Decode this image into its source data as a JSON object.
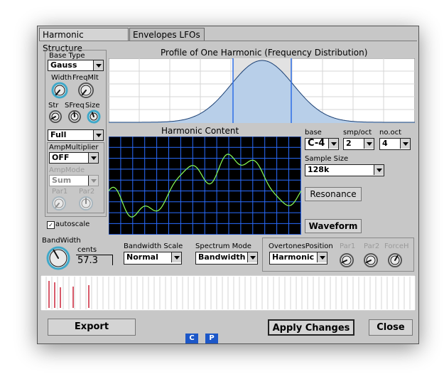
{
  "tabs": {
    "harmonic_structure": "Harmonic Structure",
    "envelopes_lfos": "Envelopes LFOs"
  },
  "base_type": {
    "label": "Base Type",
    "value": "Gauss"
  },
  "knobs": {
    "width": "Width",
    "freqmlt": "FreqMlt",
    "str": "Str",
    "sfreq": "SFreq",
    "size": "Size"
  },
  "full_select": "Full",
  "amp_multiplier": {
    "label": "AmpMultiplier",
    "value": "OFF"
  },
  "amp_mode": {
    "label": "AmpMode",
    "value": "Sum"
  },
  "par_knobs": {
    "par1": "Par1",
    "par2": "Par2"
  },
  "autoscale": {
    "label": "autoscale",
    "checked": true
  },
  "profile": {
    "title": "Profile of One Harmonic (Frequency Distribution)"
  },
  "content": {
    "title": "Harmonic Content"
  },
  "base": {
    "label": "base",
    "value": "C-4"
  },
  "smp_oct": {
    "label": "smp/oct",
    "value": "2"
  },
  "no_oct": {
    "label": "no.oct",
    "value": "4"
  },
  "sample_size": {
    "label": "Sample Size",
    "value": "128k"
  },
  "resonance_button": "Resonance",
  "waveform_button": "Waveform",
  "bandwidth": {
    "label": "BandWidth",
    "unit": "cents",
    "value": "57.3"
  },
  "bandwidth_scale": {
    "label": "Bandwidth Scale",
    "value": "Normal"
  },
  "spectrum_mode": {
    "label": "Spectrum Mode",
    "value": "Bandwidth"
  },
  "overtones": {
    "label": "OvertonesPosition",
    "value": "Harmonic",
    "par1": "Par1",
    "par2": "Par2",
    "forceh": "ForceH"
  },
  "buttons": {
    "export": "Export",
    "apply": "Apply Changes",
    "close": "Close",
    "c": "C",
    "p": "P"
  },
  "colors": {
    "window_bg": "#c7c7c7",
    "graph_bg": "#ffffff",
    "profile_fill": "#b8cfe9",
    "wave_bg": "#000000",
    "grid": "#2a6cff",
    "wave_line": "#8aff55",
    "knob_accent": "#3fa8c9",
    "cp_blue": "#1c57c8"
  }
}
